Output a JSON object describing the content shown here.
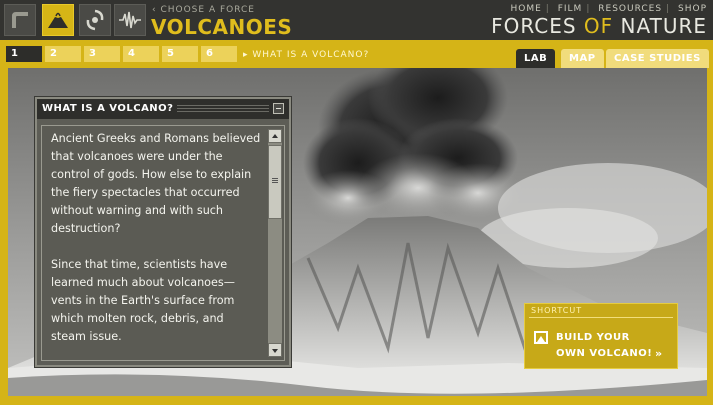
{
  "header": {
    "choose_label": "‹ CHOOSE A FORCE",
    "force_title": "VOLCANOES",
    "force_icons": [
      "hurricane-logo-icon",
      "volcano-icon",
      "hurricane-icon",
      "seismic-wave-icon"
    ],
    "nav": [
      "HOME",
      "FILM",
      "RESOURCES",
      "SHOP"
    ],
    "brand_part1": "FORCES ",
    "brand_of": "OF",
    "brand_part2": " NATURE"
  },
  "steps": {
    "items": [
      "1",
      "2",
      "3",
      "4",
      "5",
      "6"
    ],
    "active_index": 0,
    "crumb": "▸ WHAT IS A VOLCANO?"
  },
  "tabs": [
    "LAB",
    "MAP",
    "CASE STUDIES"
  ],
  "panel": {
    "title": "WHAT IS A VOLCANO?",
    "paragraph1": "Ancient Greeks and Romans believed that volcanoes were under the control of gods. How else to explain the fiery spectacles that occurred without warning and with such destruction?",
    "paragraph2": "Since that time, scientists have learned much about volcanoes—vents in the Earth's surface from which molten rock, debris, and steam issue."
  },
  "shortcut": {
    "label": "SHORTCUT",
    "line1": "BUILD YOUR",
    "line2": "OWN VOLCANO!",
    "arrow": "»"
  },
  "colors": {
    "accent": "#d5b417",
    "dark": "#2d2d2a",
    "panel": "#5d5d56"
  }
}
